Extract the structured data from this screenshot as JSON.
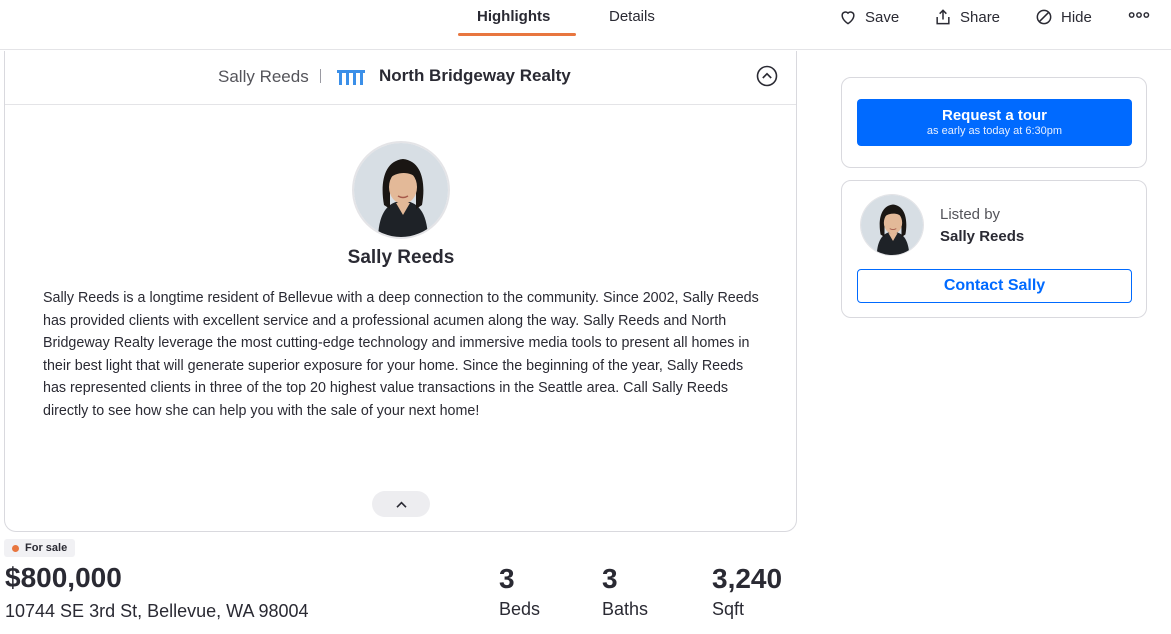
{
  "nav": {
    "tabs": [
      {
        "label": "Highlights",
        "active": true
      },
      {
        "label": "Details",
        "active": false
      }
    ],
    "actions": {
      "save": "Save",
      "share": "Share",
      "hide": "Hide"
    }
  },
  "agent_card": {
    "header_agent_name": "Sally Reeds",
    "brokerage": "North Bridgeway Realty",
    "name": "Sally Reeds",
    "bio": "Sally Reeds is a longtime resident of Bellevue with a deep connection to the community. Since 2002, Sally Reeds has provided clients with excellent service and a professional acumen along the way. Sally Reeds and North Bridgeway Realty leverage the most cutting-edge technology and immersive media tools to present all homes in their best light that will generate superior exposure for your home. Since the beginning of the year, Sally Reeds has represented clients in three of the top 20 highest value transactions in the Seattle area. Call Sally Reeds directly to see how she can help you with the sale of your next home!"
  },
  "listing": {
    "status": "For sale",
    "price": "$800,000",
    "address": "10744 SE 3rd St, Bellevue, WA 98004",
    "beds": {
      "value": "3",
      "label": "Beds"
    },
    "baths": {
      "value": "3",
      "label": "Baths"
    },
    "sqft": {
      "value": "3,240",
      "label": "Sqft"
    }
  },
  "tour": {
    "button_label": "Request a tour",
    "button_sub": "as early as today at 6:30pm"
  },
  "listed_by": {
    "label": "Listed by",
    "name": "Sally Reeds",
    "contact_label": "Contact Sally"
  },
  "colors": {
    "accent_blue": "#006aff",
    "tab_underline": "#e8763f",
    "status_dot": "#e8763f"
  }
}
